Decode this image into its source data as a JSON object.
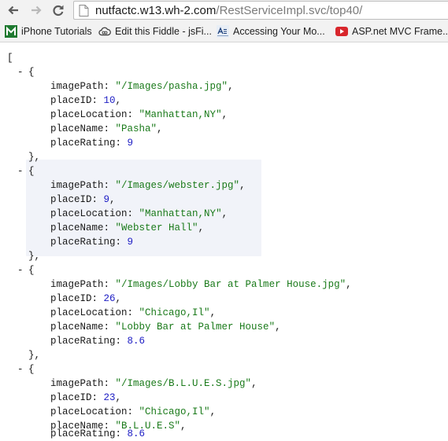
{
  "browser": {
    "url_host": "nutfactc.w13.wh-2.com",
    "url_path": "/RestServiceImpl.svc/top40/"
  },
  "bookmarks": [
    {
      "label": "iPhone Tutorials",
      "icon": "green-m-icon"
    },
    {
      "label": "Edit this Fiddle - jsFi...",
      "icon": "cloud-icon"
    },
    {
      "label": "Accessing Your Mo...",
      "icon": "asp-net-icon"
    },
    {
      "label": "ASP.net MVC Frame...",
      "icon": "youtube-icon"
    }
  ],
  "json": {
    "open_bracket": "[",
    "expander": "-",
    "open_brace": "{",
    "close_brace": "},",
    "keys": {
      "imagePath": "imagePath:",
      "placeID": "placeID:",
      "placeLocation": "placeLocation:",
      "placeName": "placeName:",
      "placeRating": "placeRating:"
    },
    "items": [
      {
        "imagePath": "\"/Images/pasha.jpg\"",
        "placeID": "10",
        "placeLocation": "\"Manhattan,NY\"",
        "placeName": "\"Pasha\"",
        "placeRating": "9"
      },
      {
        "imagePath": "\"/Images/webster.jpg\"",
        "placeID": "9",
        "placeLocation": "\"Manhattan,NY\"",
        "placeName": "\"Webster Hall\"",
        "placeRating": "9"
      },
      {
        "imagePath": "\"/Images/Lobby Bar at Palmer House.jpg\"",
        "placeID": "26",
        "placeLocation": "\"Chicago,Il\"",
        "placeName": "\"Lobby Bar at Palmer House\"",
        "placeRating": "8.6"
      },
      {
        "imagePath": "\"/Images/B.L.U.E.S.jpg\"",
        "placeID": "23",
        "placeLocation": "\"Chicago,Il\"",
        "placeName": "\"B.L.U.E.S\"",
        "placeRating": "8.6"
      }
    ]
  },
  "colors": {
    "string": "#1a7a1a",
    "number": "#1d1dc4",
    "hover_highlight": "#f1f3f9"
  }
}
